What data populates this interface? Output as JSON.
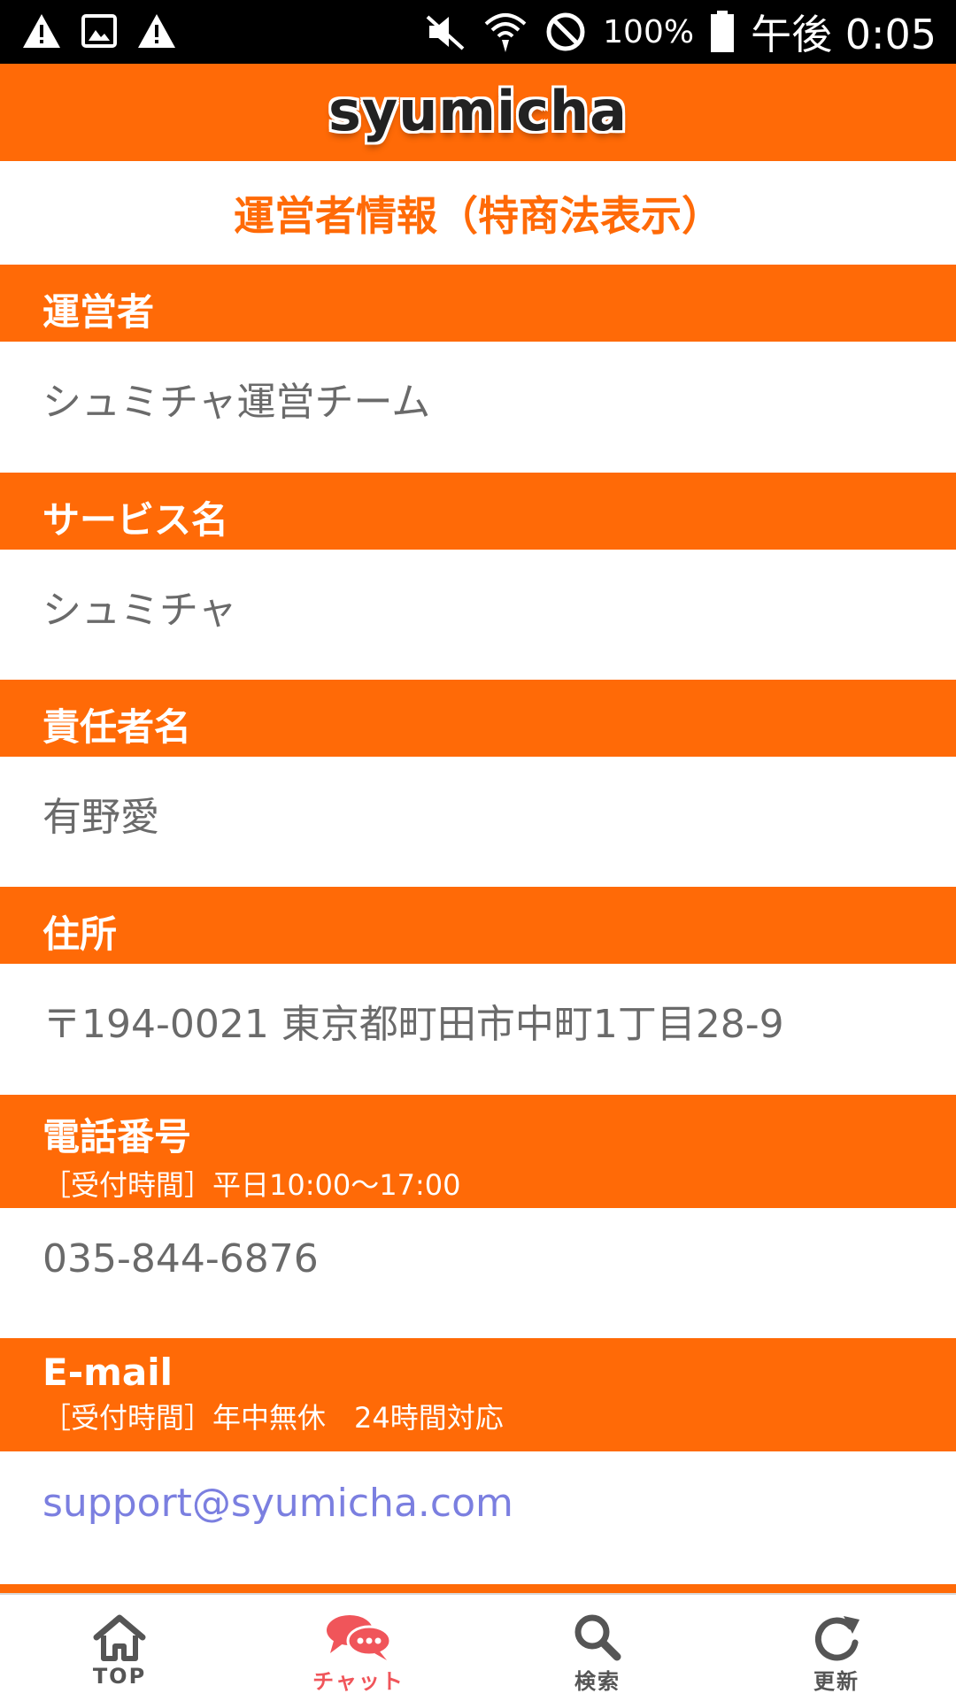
{
  "status_bar": {
    "icons_left": [
      "warning-icon",
      "image-icon",
      "warning-icon"
    ],
    "icons_right": [
      "mute-icon",
      "wifi-icon",
      "do-not-disturb-icon",
      "battery-icon"
    ],
    "battery": "100%",
    "time": "午後 0:05"
  },
  "app": {
    "logo_text": "syumicha",
    "brand_color": "#ff6a07"
  },
  "page": {
    "title": "運営者情報（特商法表示）"
  },
  "sections": [
    {
      "label": "運営者",
      "sub": "",
      "value": "シュミチャ運営チーム"
    },
    {
      "label": "サービス名",
      "sub": "",
      "value": "シュミチャ"
    },
    {
      "label": "責任者名",
      "sub": "",
      "value": "有野愛"
    },
    {
      "label": "住所",
      "sub": "",
      "value": "〒194-0021 東京都町田市中町1丁目28-9"
    },
    {
      "label": "電話番号",
      "sub": "［受付時間］平日10:00〜17:00",
      "value": "035-844-6876"
    },
    {
      "label": "E-mail",
      "sub": "［受付時間］年中無休　24時間対応",
      "value": "support@syumicha.com"
    }
  ],
  "tab_bar": {
    "tabs": [
      {
        "label": "TOP",
        "icon": "home-icon"
      },
      {
        "label": "チャット",
        "icon": "chat-icon",
        "active": true
      },
      {
        "label": "検索",
        "icon": "search-icon"
      },
      {
        "label": "更新",
        "icon": "refresh-icon"
      }
    ],
    "active_color": "#f0555a"
  }
}
